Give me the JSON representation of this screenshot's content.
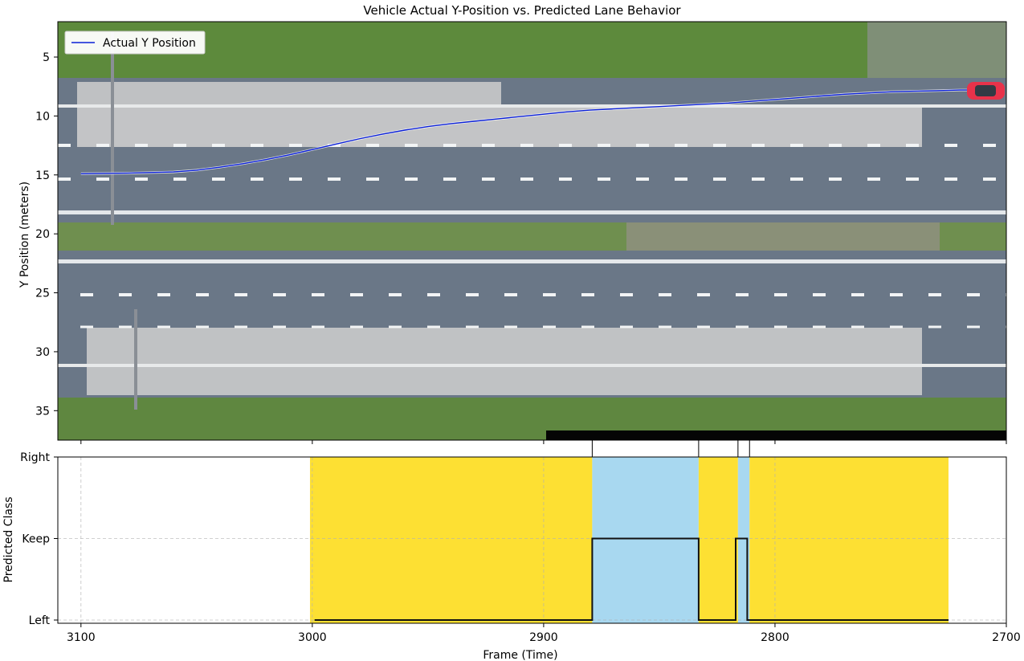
{
  "figure": {
    "title": "Vehicle Actual Y-Position vs. Predicted Lane Behavior"
  },
  "colors": {
    "trajectory": "#0a1fd6",
    "keep_band": "#fde033",
    "left_band": "#a8d8f0",
    "step_line": "#111111",
    "vehicle": "#e8324a"
  },
  "chart_data": [
    {
      "type": "line",
      "title": "Vehicle Actual Y-Position vs. Predicted Lane Behavior",
      "xlabel": "",
      "ylabel": "Y Position (meters)",
      "xlim": [
        3110,
        2700
      ],
      "ylim": [
        37.5,
        2.0
      ],
      "y_inverted": true,
      "yticks": [
        5,
        10,
        15,
        20,
        25,
        30,
        35
      ],
      "grid": false,
      "background": "aerial road image",
      "legend": {
        "position": "top-left",
        "entries": [
          "Actual Y Position"
        ]
      },
      "series": [
        {
          "name": "Actual Y Position",
          "x": [
            3100,
            3080,
            3060,
            3050,
            3040,
            3030,
            3020,
            3010,
            3000,
            2990,
            2980,
            2970,
            2960,
            2950,
            2940,
            2930,
            2920,
            2910,
            2900,
            2890,
            2880,
            2870,
            2860,
            2850,
            2840,
            2830,
            2820,
            2810,
            2800,
            2790,
            2780,
            2770,
            2760,
            2750,
            2740,
            2730,
            2720,
            2710
          ],
          "y": [
            14.9,
            14.85,
            14.75,
            14.6,
            14.35,
            14.05,
            13.7,
            13.3,
            12.85,
            12.4,
            11.95,
            11.55,
            11.2,
            10.9,
            10.65,
            10.45,
            10.25,
            10.05,
            9.85,
            9.65,
            9.5,
            9.4,
            9.3,
            9.2,
            9.1,
            9.0,
            8.9,
            8.75,
            8.6,
            8.45,
            8.3,
            8.15,
            8.05,
            7.95,
            7.9,
            7.85,
            7.8,
            7.8
          ]
        }
      ]
    },
    {
      "type": "line",
      "xlabel": "Frame (Time)",
      "ylabel": "Predicted Class",
      "xlim": [
        3110,
        2700
      ],
      "xticks": [
        3100,
        3000,
        2900,
        2800,
        2700
      ],
      "yticks": [
        "Left",
        "Keep",
        "Right"
      ],
      "grid": true,
      "series": [
        {
          "step": true,
          "x": [
            2999,
            2879,
            2879,
            2833,
            2833,
            2817,
            2817,
            2812,
            2812,
            2725
          ],
          "y": [
            "Left",
            "Left",
            "Keep",
            "Keep",
            "Left",
            "Left",
            "Keep",
            "Keep",
            "Left",
            "Left"
          ]
        }
      ],
      "bands": [
        {
          "from": 3001,
          "to": 2879,
          "class": "Keep"
        },
        {
          "from": 2879,
          "to": 2833,
          "class": "Left"
        },
        {
          "from": 2833,
          "to": 2816,
          "class": "Keep"
        },
        {
          "from": 2816,
          "to": 2811,
          "class": "Left"
        },
        {
          "from": 2811,
          "to": 2725,
          "class": "Keep"
        }
      ],
      "top_marks": [
        2879,
        2833,
        2816,
        2811
      ]
    }
  ]
}
